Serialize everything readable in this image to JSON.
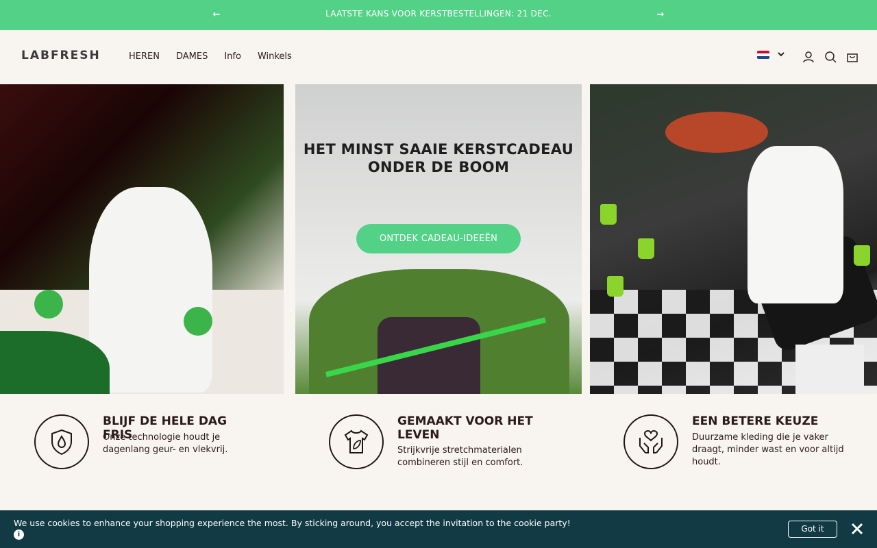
{
  "announcement": {
    "message": "LAATSTE KANS VOOR KERSTBESTELLINGEN: 21 DEC.",
    "prev_icon": "arrow-left-icon",
    "next_icon": "arrow-right-icon"
  },
  "header": {
    "logo": "LABFRESH",
    "nav": [
      "HEREN",
      "DAMES",
      "Info",
      "Winkels"
    ],
    "locale_flag": "netherlands-flag-icon",
    "icons": [
      "chevron-down-icon",
      "account-icon",
      "search-icon",
      "cart-icon"
    ]
  },
  "hero": {
    "headline_line1": "HET MINST SAAIE KERSTCADEAU",
    "headline_line2": "ONDER DE BOOM",
    "cta_label": "ONTDEK CADEAU-IDEEËN"
  },
  "usps": [
    {
      "icon": "drop-shield-icon",
      "title": "BLIJF DE HELE DAG FRIS",
      "description": "Onze technologie houdt je dagenlang geur- en vlekvrij."
    },
    {
      "icon": "tshirt-leaf-icon",
      "title": "GEMAAKT VOOR HET LEVEN",
      "description": "Strijkvrije stretchmaterialen combineren stijl en comfort."
    },
    {
      "icon": "hands-heart-icon",
      "title": "EEN BETERE KEUZE",
      "description": "Duurzame kleding die je vaker draagt, minder wast en voor altijd houdt."
    }
  ],
  "cookie": {
    "text": "We use cookies to enhance your shopping experience the most. By sticking around, you accept the invitation to the cookie party!",
    "info_symbol": "i",
    "button_label": "Got it",
    "close_icon": "close-icon"
  },
  "colors": {
    "accent": "#52d187",
    "background": "#f8f4f0",
    "cookie_bar": "#113a45",
    "text": "#2b2020"
  }
}
